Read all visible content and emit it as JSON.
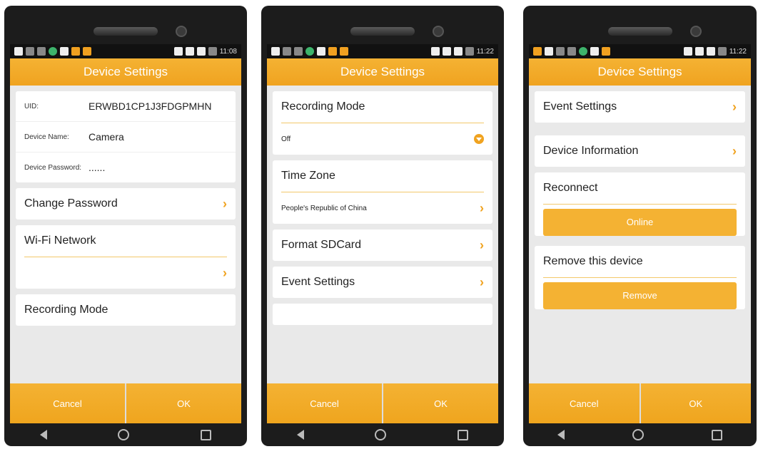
{
  "colors": {
    "accent": "#f0a320",
    "header": "#f4b233",
    "bg": "#e9e9e9"
  },
  "screens": [
    {
      "time": "11:08",
      "title": "Device Settings",
      "uid_label": "UID:",
      "uid_value": "ERWBD1CP1J3FDGPMHN",
      "device_name_label": "Device Name:",
      "device_name_value": "Camera",
      "device_password_label": "Device Password:",
      "device_password_value": "......",
      "change_password": "Change Password",
      "wifi_network": "Wi-Fi Network",
      "recording_mode": "Recording Mode",
      "cancel": "Cancel",
      "ok": "OK"
    },
    {
      "time": "11:22",
      "title": "Device Settings",
      "recording_mode": "Recording Mode",
      "recording_value": "Off",
      "time_zone": "Time Zone",
      "time_zone_value": "People's Republic of China",
      "format_sdcard": "Format SDCard",
      "event_settings": "Event Settings",
      "cancel": "Cancel",
      "ok": "OK"
    },
    {
      "time": "11:22",
      "title": "Device Settings",
      "event_settings": "Event Settings",
      "device_information": "Device Information",
      "reconnect": "Reconnect",
      "online": "Online",
      "remove_device": "Remove this device",
      "remove": "Remove",
      "cancel": "Cancel",
      "ok": "OK"
    }
  ]
}
